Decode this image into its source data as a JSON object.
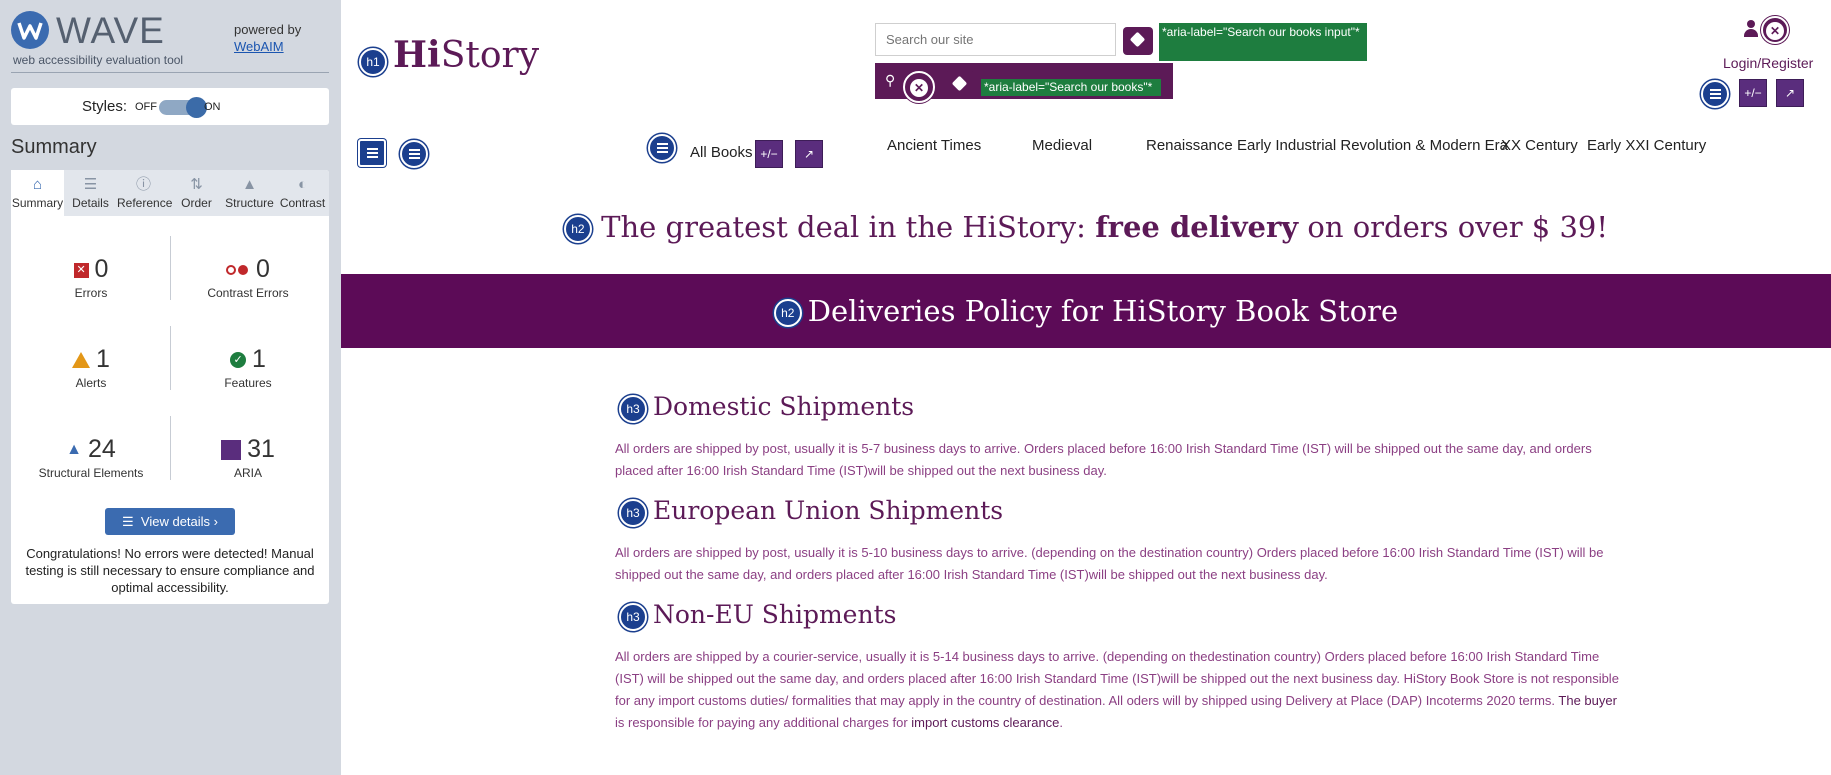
{
  "wave": {
    "brand": "WAVE",
    "subtitle": "web accessibility evaluation tool",
    "powered_by": "powered by",
    "webaim": "WebAIM",
    "styles_label": "Styles:",
    "styles_off": "OFF",
    "styles_on": "ON",
    "summary_title": "Summary",
    "tabs": [
      {
        "label": "Summary",
        "icon": "home-icon"
      },
      {
        "label": "Details",
        "icon": "details-list-icon"
      },
      {
        "label": "Reference",
        "icon": "info-icon"
      },
      {
        "label": "Order",
        "icon": "order-icon"
      },
      {
        "label": "Structure",
        "icon": "structure-icon"
      },
      {
        "label": "Contrast",
        "icon": "contrast-icon"
      }
    ],
    "metrics": {
      "errors": {
        "count": "0",
        "label": "Errors"
      },
      "contrast_errors": {
        "count": "0",
        "label": "Contrast Errors"
      },
      "alerts": {
        "count": "1",
        "label": "Alerts"
      },
      "features": {
        "count": "1",
        "label": "Features"
      },
      "structural": {
        "count": "24",
        "label": "Structural Elements"
      },
      "aria": {
        "count": "31",
        "label": "ARIA"
      }
    },
    "view_details": "View details ›",
    "congrats": "Congratulations! No errors were detected! Manual testing is still necessary to ensure compliance and optimal accessibility.",
    "colors": {
      "sidebar_bg": "#d3d8e0",
      "accent": "#3b6bb0",
      "error": "#c0282b",
      "alert": "#e39717",
      "feature": "#1e7d3f",
      "aria": "#5a2d7d"
    }
  },
  "site": {
    "logo_hi": "Hi",
    "logo_story": "Story",
    "h1_badge": "h1",
    "search_placeholder": "Search our site",
    "aria_label_input": "*aria-label=\"Search our books input\"*",
    "aria_label_button": "*aria-label=\"Search our books\"*",
    "login": "Login/Register",
    "nav": {
      "all_books": "All Books",
      "items": [
        "Ancient Times",
        "Medieval",
        "Renaissance",
        "Early Industrial Revolution & Modern Era",
        "XX Century",
        "Early XXI Century"
      ]
    },
    "promo": {
      "badge": "h2",
      "text_before": "The greatest deal in the HiStory: ",
      "text_bold": "free delivery",
      "text_after": " on orders over $ 39!"
    },
    "band": {
      "badge": "h2",
      "title": "Deliveries Policy for HiStory Book Store"
    },
    "sections": [
      {
        "badge": "h3",
        "title": "Domestic Shipments",
        "text": "All orders are shipped by post, usually it is 5-7 business days to arrive. Orders placed before 16:00 Irish Standard Time (IST) will be shipped out the same day, and orders placed after 16:00 Irish Standard Time (IST)will be shipped out the next business day."
      },
      {
        "badge": "h3",
        "title": "European Union Shipments",
        "text": "All orders are shipped by post, usually it is 5-10 business days to arrive. (depending on the destination country) Orders placed before 16:00 Irish Standard Time (IST) will be shipped out the same day, and orders placed after 16:00 Irish Standard Time (IST)will be shipped out the next business day."
      },
      {
        "badge": "h3",
        "title": "Non-EU Shipments",
        "text_before": "All orders are shipped by a courier-service, usually it is 5-14 business days to arrive. (depending on thedestination country) Orders placed before 16:00 Irish Standard Time (IST) will be shipped out the same day, and orders placed after 16:00 Irish Standard Time (IST)will be shipped out the next business day. HiStory Book Store is not responsible for any import customs duties/ formalities that may apply in the country of destination. All oders will by shipped using Delivery at Place (DAP) Incoterms 2020 terms. ",
        "text_bold1": "The buyer",
        "text_mid": " is responsible for paying any additional charges for ",
        "text_bold2": "import customs clearance",
        "text_end": "."
      }
    ],
    "aria_icon_text": "+/−",
    "colors": {
      "brand": "#5c1a57",
      "band": "#5c0b57",
      "body_text": "#8b3f83",
      "heading_badge": "#1b3f8e"
    }
  }
}
